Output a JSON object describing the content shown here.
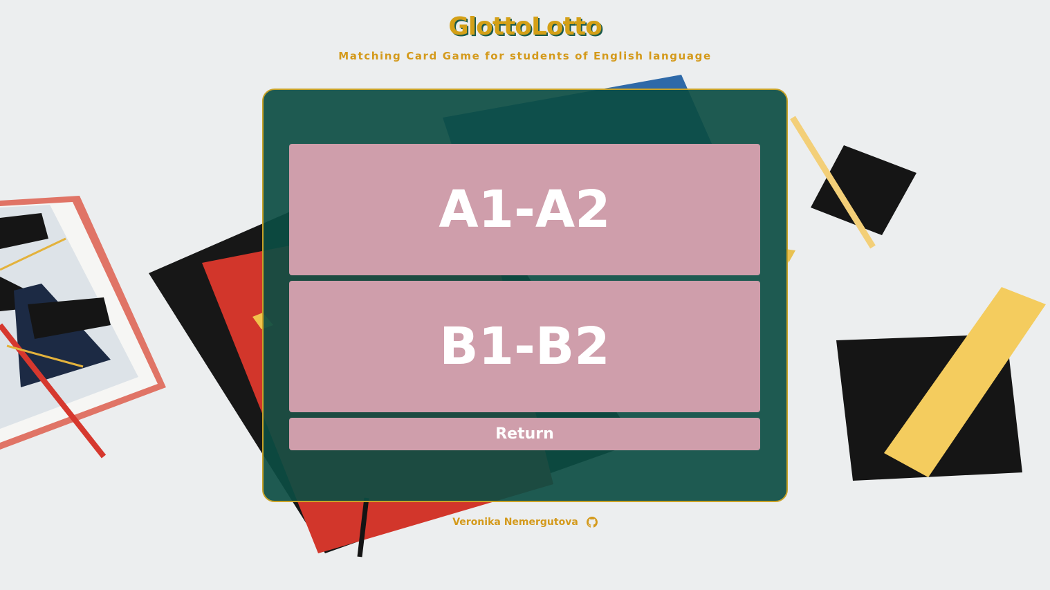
{
  "header": {
    "title": "GlottoLotto",
    "subtitle": "Matching Card Game for students of English language"
  },
  "levels": [
    {
      "label": "A1-A2"
    },
    {
      "label": "B1-B2"
    }
  ],
  "return_label": "Return",
  "footer": {
    "author": "Veronika Nemergutova",
    "icon": "github-icon"
  },
  "colors": {
    "accent": "#d49a1c",
    "panel": "#0c4d43",
    "button": "#cf9eab",
    "background": "#eceeef"
  }
}
